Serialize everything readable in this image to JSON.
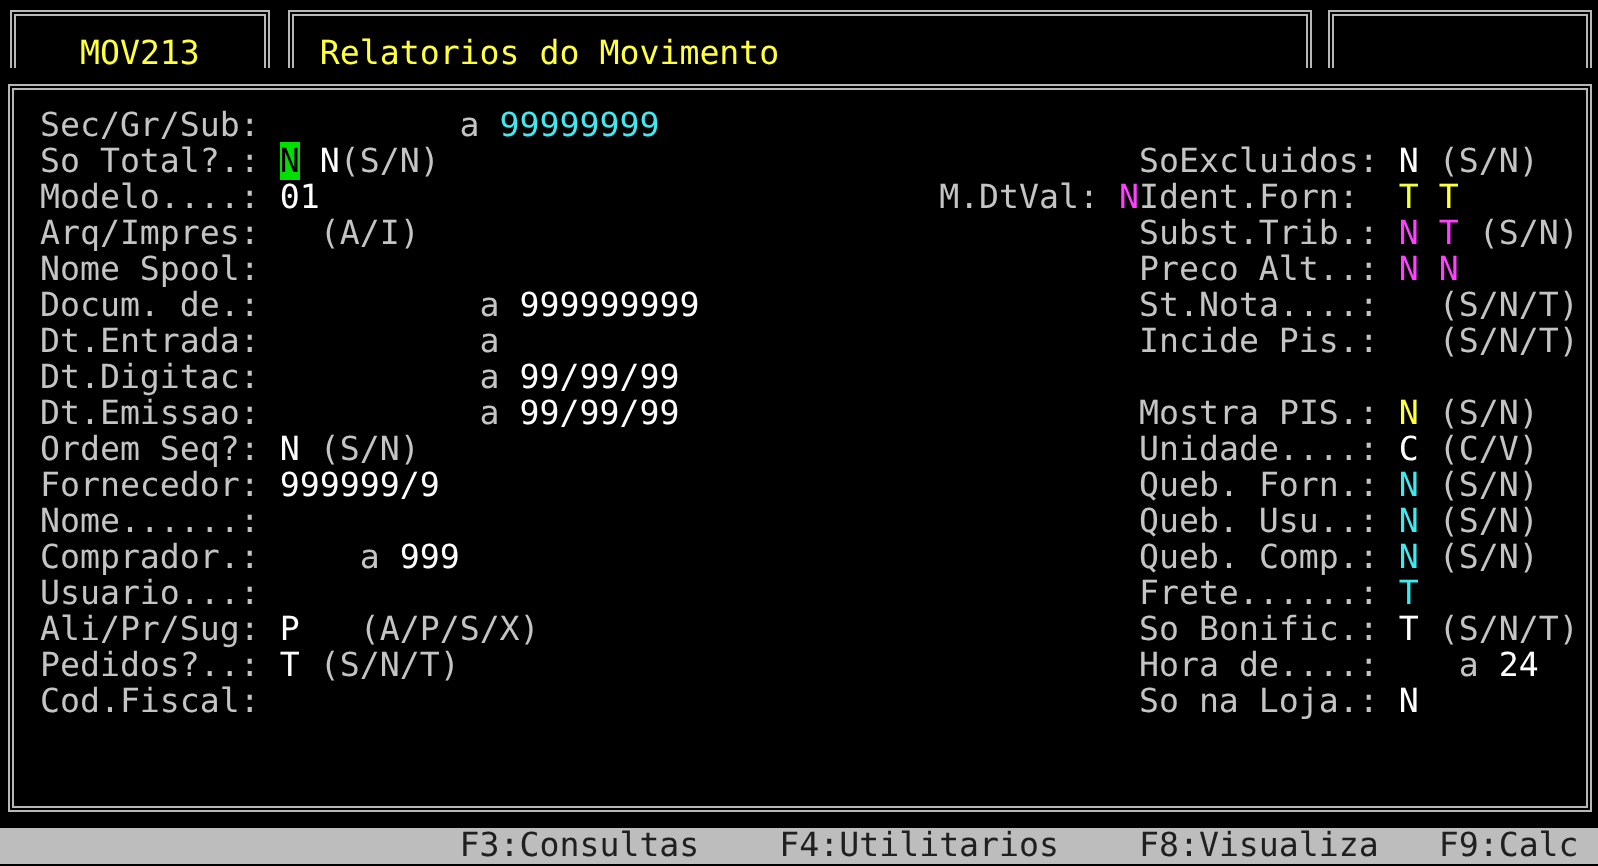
{
  "header": {
    "program_code": "MOV213",
    "title": "Relatorios do Movimento"
  },
  "left_fields": [
    {
      "label": "Sec/Gr/Sub:",
      "parts": [
        {
          "kind": "separator",
          "text": "a"
        },
        {
          "kind": "value",
          "text": "99999999",
          "color": "#40e8f0"
        }
      ]
    },
    {
      "label": "So Total?.:",
      "parts": [
        {
          "kind": "value",
          "text": "N",
          "color": "#00e000",
          "focused": true
        },
        {
          "kind": "value",
          "text": "N",
          "color": "#ffffff"
        },
        {
          "kind": "hint",
          "text": "(S/N)"
        }
      ]
    },
    {
      "label": "Modelo....:",
      "parts": [
        {
          "kind": "value",
          "text": "01",
          "color": "#ffffff"
        }
      ]
    },
    {
      "label": "Arq/Impres:",
      "parts": [
        {
          "kind": "hint",
          "text": "(A/I)"
        }
      ]
    },
    {
      "label": "Nome Spool:"
    },
    {
      "label": "Docum. de.:",
      "parts": [
        {
          "kind": "separator",
          "text": "a"
        },
        {
          "kind": "value",
          "text": "999999999",
          "color": "#ffffff"
        }
      ]
    },
    {
      "label": "Dt.Entrada:",
      "parts": [
        {
          "kind": "separator",
          "text": "a"
        }
      ]
    },
    {
      "label": "Dt.Digitac:",
      "parts": [
        {
          "kind": "separator",
          "text": "a"
        },
        {
          "kind": "value",
          "text": "99/99/99",
          "color": "#ffffff"
        }
      ]
    },
    {
      "label": "Dt.Emissao:",
      "parts": [
        {
          "kind": "separator",
          "text": "a"
        },
        {
          "kind": "value",
          "text": "99/99/99",
          "color": "#ffffff"
        }
      ]
    },
    {
      "label": "Ordem Seq?:",
      "parts": [
        {
          "kind": "value",
          "text": "N",
          "color": "#ffffff"
        },
        {
          "kind": "hint",
          "text": "(S/N)"
        }
      ]
    },
    {
      "label": "Fornecedor:",
      "parts": [
        {
          "kind": "value",
          "text": "999999/9",
          "color": "#ffffff"
        }
      ]
    },
    {
      "label": "Nome......:"
    },
    {
      "label": "Comprador.:",
      "parts": [
        {
          "kind": "separator",
          "text": "a"
        },
        {
          "kind": "value",
          "text": "999",
          "color": "#ffffff"
        }
      ]
    },
    {
      "label": "Usuario...:"
    },
    {
      "label": "Ali/Pr/Sug:",
      "parts": [
        {
          "kind": "value",
          "text": "P",
          "color": "#ffffff"
        },
        {
          "kind": "hint",
          "text": "(A/P/S/X)"
        }
      ]
    },
    {
      "label": "Pedidos?..:",
      "parts": [
        {
          "kind": "value",
          "text": "T",
          "color": "#ffffff"
        },
        {
          "kind": "hint",
          "text": "(S/N/T)"
        }
      ]
    },
    {
      "label": "Cod.Fiscal:"
    }
  ],
  "right_fields": [
    {
      "label": "SoExcluidos:",
      "parts": [
        {
          "kind": "value",
          "text": "N",
          "color": "#ffffff"
        },
        {
          "kind": "hint",
          "text": "(S/N)"
        }
      ]
    },
    {
      "label": "Ident.Forn:",
      "lead_label": "M.DtVal:",
      "lead_value": {
        "text": "N",
        "color": "#ff40ff"
      },
      "parts": [
        {
          "kind": "value",
          "text": "T",
          "color": "#f0ff40"
        },
        {
          "kind": "value",
          "text": "T",
          "color": "#ffff40"
        }
      ]
    },
    {
      "label": "Subst.Trib.:",
      "parts": [
        {
          "kind": "value",
          "text": "N",
          "color": "#ff40ff"
        },
        {
          "kind": "value",
          "text": "T",
          "color": "#ff40ff"
        },
        {
          "kind": "hint",
          "text": "(S/N)"
        }
      ]
    },
    {
      "label": "Preco Alt..:",
      "parts": [
        {
          "kind": "value",
          "text": "N",
          "color": "#ff40ff"
        },
        {
          "kind": "value",
          "text": "N",
          "color": "#ff40ff"
        }
      ]
    },
    {
      "label": "St.Nota....:",
      "parts": [
        {
          "kind": "hint",
          "text": "(S/N/T)"
        }
      ]
    },
    {
      "label": "Incide Pis.:",
      "parts": [
        {
          "kind": "hint",
          "text": "(S/N/T)"
        }
      ]
    },
    {
      "label": "Mostra PIS.:",
      "parts": [
        {
          "kind": "value",
          "text": "N",
          "color": "#ffff40"
        },
        {
          "kind": "hint",
          "text": "(S/N)"
        }
      ]
    },
    {
      "label": "Unidade....:",
      "parts": [
        {
          "kind": "value",
          "text": "C",
          "color": "#ffffff"
        },
        {
          "kind": "hint",
          "text": "(C/V)"
        }
      ]
    },
    {
      "label": "Queb. Forn.:",
      "parts": [
        {
          "kind": "value",
          "text": "N",
          "color": "#40e8f0"
        },
        {
          "kind": "hint",
          "text": "(S/N)"
        }
      ]
    },
    {
      "label": "Queb. Usu..:",
      "parts": [
        {
          "kind": "value",
          "text": "N",
          "color": "#40e8f0"
        },
        {
          "kind": "hint",
          "text": "(S/N)"
        }
      ]
    },
    {
      "label": "Queb. Comp.:",
      "parts": [
        {
          "kind": "value",
          "text": "N",
          "color": "#40e8f0"
        },
        {
          "kind": "hint",
          "text": "(S/N)"
        }
      ]
    },
    {
      "label": "Frete......:",
      "parts": [
        {
          "kind": "value",
          "text": "T",
          "color": "#40e8f0"
        }
      ]
    },
    {
      "label": "So Bonific.:",
      "parts": [
        {
          "kind": "value",
          "text": "T",
          "color": "#ffffff"
        },
        {
          "kind": "hint",
          "text": "(S/N/T)"
        }
      ]
    },
    {
      "label": "Hora de....:",
      "parts": [
        {
          "kind": "separator",
          "text": "a"
        },
        {
          "kind": "value",
          "text": "24",
          "color": "#ffffff"
        }
      ]
    },
    {
      "label": "So na Loja.:",
      "parts": [
        {
          "kind": "value",
          "text": "N",
          "color": "#ffffff"
        }
      ]
    }
  ],
  "function_keys": [
    "F3:Consultas",
    "F4:Utilitarios",
    "F8:Visualiza",
    "F9:Calc"
  ]
}
